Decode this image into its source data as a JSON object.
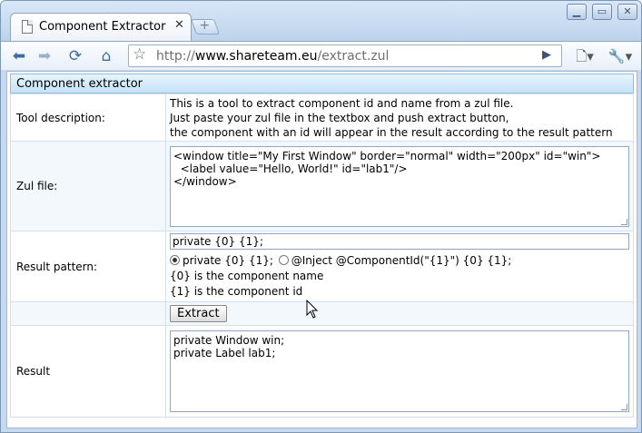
{
  "browser": {
    "tab_title": "Component Extractor",
    "tab_close": "✕",
    "url_dim_prefix": "http://",
    "url_domain": "www.shareteam.eu",
    "url_path": "/extract.zul"
  },
  "panel": {
    "title": "Component extractor"
  },
  "rows": {
    "description_label": "Tool description:",
    "description_lines": [
      "This is a tool to extract component id and name from a zul file.",
      "Just paste your zul file in the textbox and push extract button,",
      "the component with an id will appear in the result according to the result pattern"
    ],
    "zul_label": "Zul file:",
    "zul_value": "<window title=\"My First Window\" border=\"normal\" width=\"200px\" id=\"win\">\n  <label value=\"Hello, World!\" id=\"lab1\"/>\n</window>",
    "pattern_label": "Result pattern:",
    "pattern_value": "private {0} {1};",
    "radio_option_1": "private {0} {1};",
    "radio_option_2": "@Inject @ComponentId(\"{1}\") {0} {1};",
    "hint_1": "{0} is the component name",
    "hint_2": "{1} is the component id",
    "extract_button": "Extract",
    "result_label": "Result",
    "result_value": "private Window win;\nprivate Label lab1;"
  }
}
